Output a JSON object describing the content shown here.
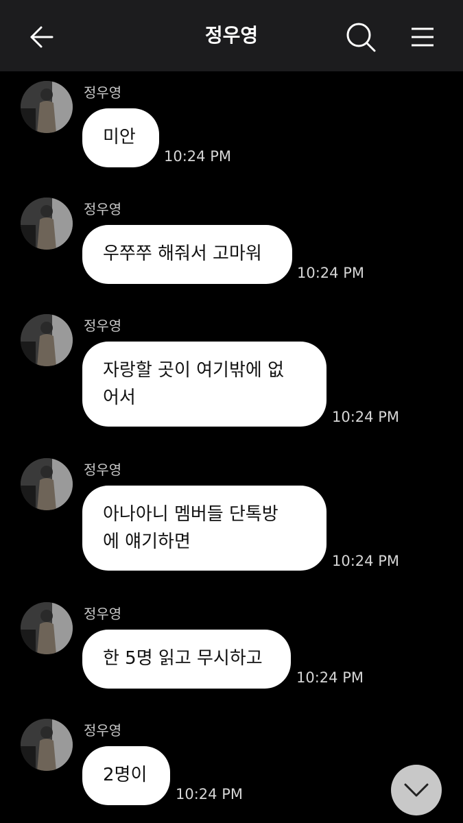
{
  "header": {
    "title": "정우영",
    "back_icon": "arrow-left-icon",
    "search_icon": "search-icon",
    "menu_icon": "menu-icon"
  },
  "messages": [
    {
      "sender": "정우영",
      "text": "미안",
      "time": "10:24 PM"
    },
    {
      "sender": "정우영",
      "text": "우쭈쭈 해줘서 고마워",
      "time": "10:24 PM"
    },
    {
      "sender": "정우영",
      "text": "자랑할 곳이 여기밖에 없\n어서",
      "time": "10:24 PM"
    },
    {
      "sender": "정우영",
      "text": "아나아니 멤버들 단톡방\n에 얘기하면",
      "time": "10:24 PM"
    },
    {
      "sender": "정우영",
      "text": "한 5명 읽고 무시하고",
      "time": "10:24 PM"
    },
    {
      "sender": "정우영",
      "text": "2명이",
      "time": "10:24 PM"
    }
  ],
  "scroll_down": {
    "icon": "chevron-down-icon"
  },
  "colors": {
    "background": "#000000",
    "header_bg": "#1c1c1e",
    "bubble_bg": "#ffffff",
    "bubble_text": "#111111",
    "time_text": "#d6d6d6",
    "scroll_button_bg": "#c8c8c8"
  }
}
